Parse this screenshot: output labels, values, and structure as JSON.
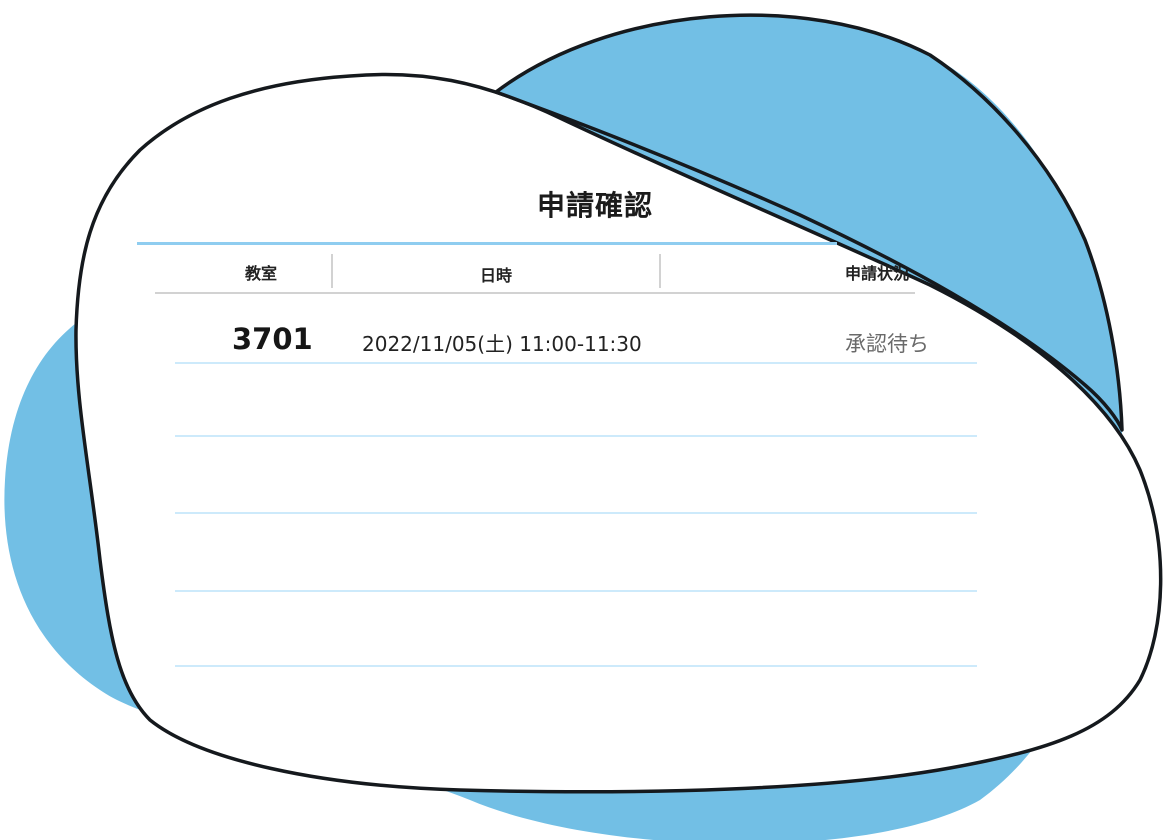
{
  "title": "申請確認",
  "columns": [
    "教室",
    "日時",
    "申請状況"
  ],
  "rows": [
    {
      "room": "3701",
      "datetime": "2022/11/05(土) 11:00-11:30",
      "status": "承認待ち"
    }
  ],
  "colors": {
    "accent": "#72bfe5",
    "line": "#cdeafb",
    "outline": "#15191d"
  }
}
